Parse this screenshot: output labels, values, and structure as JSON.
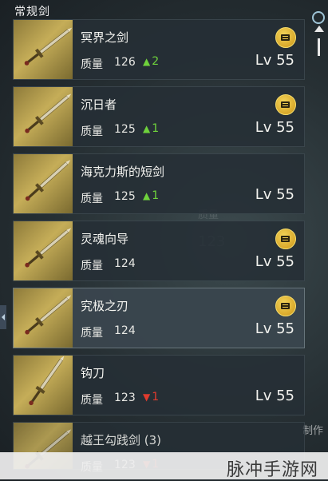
{
  "header": {
    "title": "常规剑"
  },
  "background_text": {
    "quality_label": "质量",
    "quality_value": "123",
    "corner_label": "制作"
  },
  "items": [
    {
      "name": "冥界之剑",
      "quality_label": "质量",
      "quality": "126",
      "trend": "up",
      "trend_value": "2",
      "level": "Lv 55",
      "has_chest": true,
      "selected": false
    },
    {
      "name": "沉日者",
      "quality_label": "质量",
      "quality": "125",
      "trend": "up",
      "trend_value": "1",
      "level": "Lv 55",
      "has_chest": true,
      "selected": false
    },
    {
      "name": "海克力斯的短剑",
      "quality_label": "质量",
      "quality": "125",
      "trend": "up",
      "trend_value": "1",
      "level": "Lv 55",
      "has_chest": false,
      "selected": false
    },
    {
      "name": "灵魂向导",
      "quality_label": "质量",
      "quality": "124",
      "trend": "",
      "trend_value": "",
      "level": "Lv 55",
      "has_chest": true,
      "selected": false
    },
    {
      "name": "究极之刃",
      "quality_label": "质量",
      "quality": "124",
      "trend": "",
      "trend_value": "",
      "level": "Lv 55",
      "has_chest": true,
      "selected": true
    },
    {
      "name": "钩刀",
      "quality_label": "质量",
      "quality": "123",
      "trend": "down",
      "trend_value": "1",
      "level": "Lv 55",
      "has_chest": false,
      "selected": false
    },
    {
      "name": "越王勾践剑 (3)",
      "quality_label": "质量",
      "quality": "123",
      "trend": "down",
      "trend_value": "1",
      "level": "",
      "has_chest": false,
      "selected": false
    }
  ],
  "watermark": {
    "text": "脉冲手游网"
  },
  "colors": {
    "trend_up": "#6fd23c",
    "trend_down": "#e03b2e",
    "chest": "#d9a92b"
  },
  "icons": {
    "chest": "chest-icon",
    "scroll": "scroll-up-icon",
    "top": "circle-icon"
  }
}
